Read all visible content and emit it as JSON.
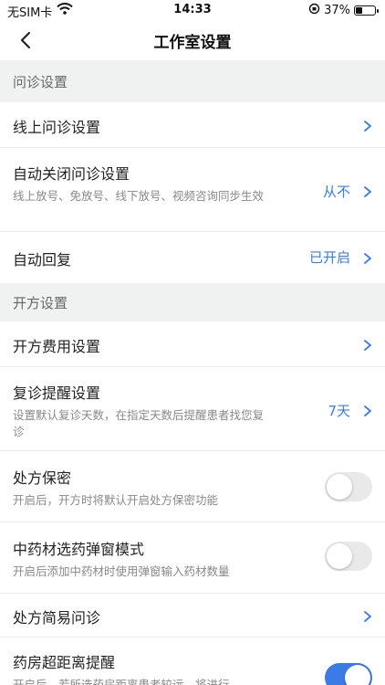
{
  "status": {
    "carrier": "无SIM卡",
    "time": "14:33",
    "battery": "37%",
    "battery_level": 0.37
  },
  "nav": {
    "title": "工作室设置"
  },
  "sections": [
    {
      "title": "问诊设置"
    },
    {
      "title": "开方设置"
    }
  ],
  "rows": {
    "online_consult": {
      "label": "线上问诊设置"
    },
    "auto_close": {
      "label": "自动关闭问诊设置",
      "sub": "线上放号、免放号、线下放号、视频咨询同步生效",
      "value": "从不"
    },
    "auto_reply": {
      "label": "自动回复",
      "value": "已开启"
    },
    "rx_fee": {
      "label": "开方费用设置"
    },
    "followup": {
      "label": "复诊提醒设置",
      "sub": "设置默认复诊天数，在指定天数后提醒患者找您复诊",
      "value": "7天"
    },
    "rx_secret": {
      "label": "处方保密",
      "sub": "开启后，开方时将默认开启处方保密功能",
      "toggle_on": false
    },
    "herb_popup": {
      "label": "中药材选药弹窗模式",
      "sub": "开启后添加中药材时使用弹窗输入药材数量",
      "toggle_on": false
    },
    "rx_simple": {
      "label": "处方简易问诊"
    },
    "pharmacy_distance": {
      "label": "药房超距离提醒",
      "sub": "开启后，若所选药房距离患者较远，将进行",
      "toggle_on": true
    }
  }
}
